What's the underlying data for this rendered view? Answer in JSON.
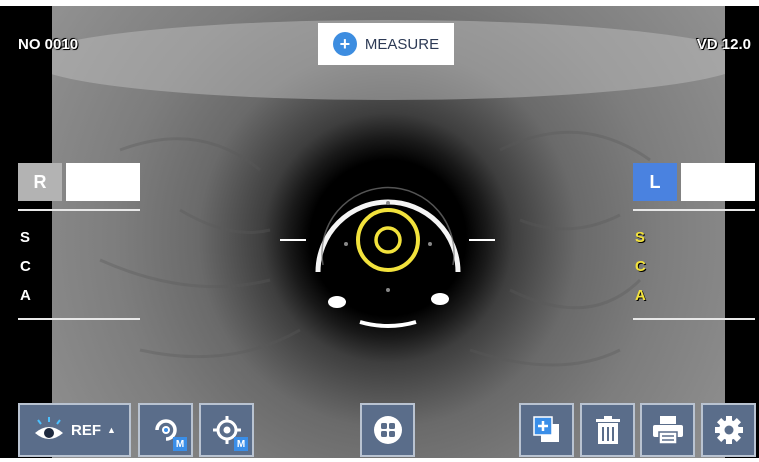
{
  "header": {
    "number_label": "NO 0010",
    "vd_label": "VD 12.0",
    "measure_label": "MEASURE"
  },
  "right_eye": {
    "label": "R",
    "rows": [
      "S",
      "C",
      "A"
    ]
  },
  "left_eye": {
    "label": "L",
    "rows": [
      "S",
      "C",
      "A"
    ]
  },
  "toolbar": {
    "ref_label": "REF",
    "ref_arrow": "▲",
    "mode_badge": "M"
  },
  "icons": {
    "measure": "plus-circle-icon",
    "ref": "eye-icon",
    "auto_track": "rotate-eye-icon",
    "auto_align": "crosshair-icon",
    "menu": "grid-icon",
    "add": "add-copy-icon",
    "delete": "trash-icon",
    "print": "printer-icon",
    "settings": "gear-icon"
  },
  "colors": {
    "left_values": "#f2e23c",
    "right_values": "#ffffff",
    "left_badge": "#4a82e0",
    "right_badge": "#b3b3b3",
    "toolbar": "#5a6d8a",
    "target_ring": "#f2e23c"
  }
}
